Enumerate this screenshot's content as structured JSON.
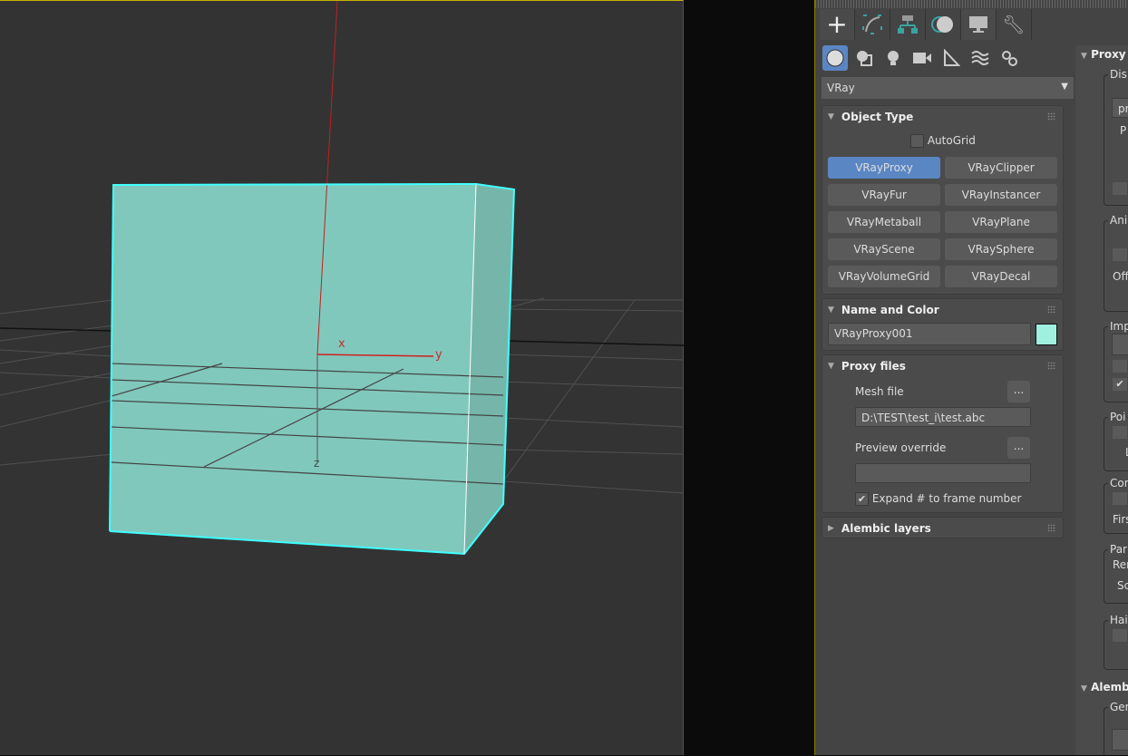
{
  "viewport": {
    "gizmo": {
      "x_label": "x",
      "y_label": "y",
      "z_label": "z"
    },
    "object_color": "#80c8bc",
    "selection_color": "#40ffff"
  },
  "command_panel": {
    "tabs": [
      {
        "name": "create",
        "icon": "plus-icon",
        "active": true
      },
      {
        "name": "modify",
        "icon": "modify-curve-icon"
      },
      {
        "name": "hierarchy",
        "icon": "hierarchy-icon"
      },
      {
        "name": "motion",
        "icon": "motion-icon"
      },
      {
        "name": "display",
        "icon": "monitor-icon"
      },
      {
        "name": "utilities",
        "icon": "wrench-icon"
      }
    ],
    "categories": [
      {
        "name": "geometry",
        "icon": "sphere-icon",
        "active": true
      },
      {
        "name": "shapes",
        "icon": "shapes-icon"
      },
      {
        "name": "lights",
        "icon": "lightbulb-icon"
      },
      {
        "name": "cameras",
        "icon": "camera-icon"
      },
      {
        "name": "helpers",
        "icon": "ruler-triangle-icon"
      },
      {
        "name": "space-warps",
        "icon": "waves-icon"
      },
      {
        "name": "systems",
        "icon": "gears-icon"
      }
    ],
    "dropdown": {
      "value": "VRay"
    },
    "object_type": {
      "title": "Object Type",
      "autogrid_label": "AutoGrid",
      "autogrid_checked": false,
      "buttons": [
        "VRayProxy",
        "VRayClipper",
        "VRayFur",
        "VRayInstancer",
        "VRayMetaball",
        "VRayPlane",
        "VRayScene",
        "VRaySphere",
        "VRayVolumeGrid",
        "VRayDecal"
      ],
      "active_button": "VRayProxy",
      "active_color": "#5b86c4"
    },
    "name_and_color": {
      "title": "Name and Color",
      "name_value": "VRayProxy001",
      "swatch_color": "#a0f0e0"
    },
    "proxy_files": {
      "title": "Proxy files",
      "mesh_file_label": "Mesh file",
      "mesh_file_value": "D:\\TEST\\test_i\\test.abc",
      "browse_label": "...",
      "preview_override_label": "Preview override",
      "preview_override_value": "",
      "expand_label": "Expand # to frame number",
      "expand_checked": true
    },
    "alembic_layers": {
      "title": "Alembic layers"
    },
    "right_column": {
      "proxy_title": "Proxy",
      "dis": "Dis",
      "pr": "pr",
      "p": "P",
      "ani": "Ani",
      "off": "Off",
      "imp": "Imp",
      "check": "✔",
      "poi": "Poi",
      "l": "L",
      "con": "Con",
      "firs": "Firs",
      "par": "Par",
      "ren": "Ren",
      "sc": "Sc",
      "hai": "Hai",
      "alembic_title": "Alemb",
      "gen": "Gen"
    }
  }
}
